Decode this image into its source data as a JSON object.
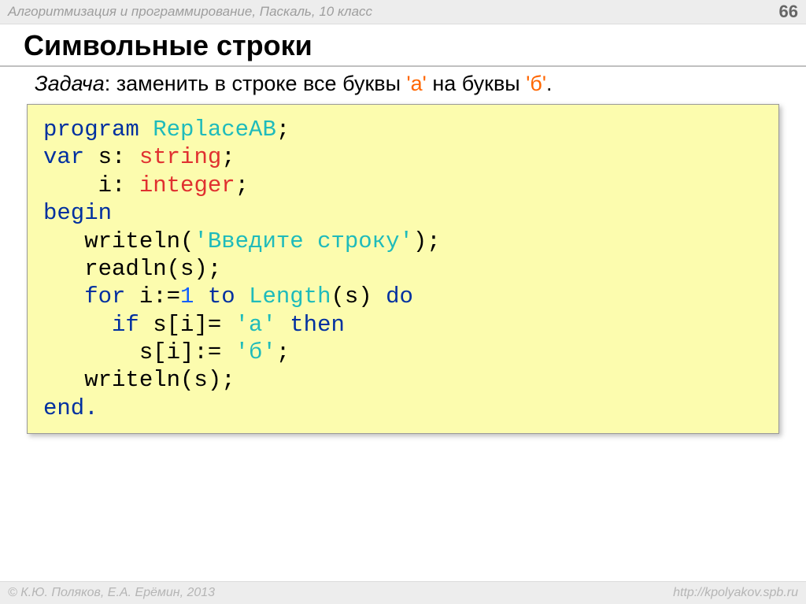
{
  "header": {
    "breadcrumb": "Алгоритмизация и программирование, Паскаль, 10 класс",
    "page_number": "66"
  },
  "title": "Символьные строки",
  "task": {
    "label": "Задача",
    "sep": ": ",
    "part1": "заменить в строке все буквы ",
    "lit1": "'а'",
    "part2": " на буквы ",
    "lit2": "'б'",
    "tail": "."
  },
  "code": {
    "l1a": "program ",
    "l1b": "ReplaceAB",
    "l1c": ";",
    "l2a": "var ",
    "l2b": "s: ",
    "l2c": "string",
    "l2d": ";",
    "l3a": "    i: ",
    "l3b": "integer",
    "l3c": ";",
    "l4a": "begin",
    "l5a": "   writeln(",
    "l5b": "'Введите строку'",
    "l5c": ");",
    "l6a": "   readln(s);",
    "l7a": "   for ",
    "l7b": "i:=",
    "l7c": "1",
    "l7d": " to ",
    "l7e": "Length",
    "l7f": "(s) ",
    "l7g": "do",
    "l8a": "     if ",
    "l8b": "s[i]= ",
    "l8c": "'а'",
    "l8d": " then",
    "l9a": "       s[i]:= ",
    "l9b": "'б'",
    "l9c": ";",
    "l10a": "   writeln(s);",
    "l11a": "end."
  },
  "footer": {
    "left": "© К.Ю. Поляков, Е.А. Ерёмин, 2013",
    "right": "http://kpolyakov.spb.ru"
  }
}
